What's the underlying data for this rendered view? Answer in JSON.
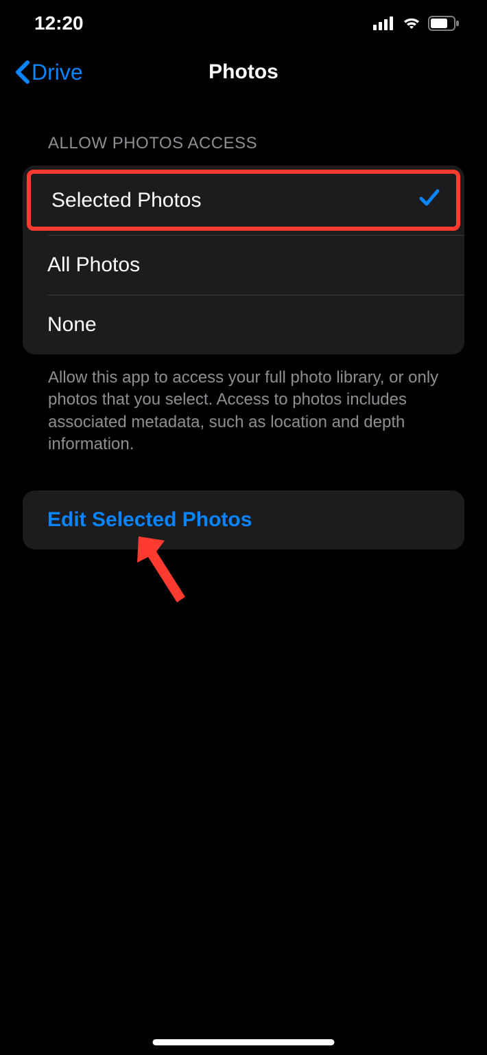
{
  "statusBar": {
    "time": "12:20"
  },
  "nav": {
    "backLabel": "Drive",
    "title": "Photos"
  },
  "section": {
    "header": "ALLOW PHOTOS ACCESS",
    "options": [
      {
        "label": "Selected Photos",
        "selected": true,
        "highlighted": true
      },
      {
        "label": "All Photos",
        "selected": false,
        "highlighted": false
      },
      {
        "label": "None",
        "selected": false,
        "highlighted": false
      }
    ],
    "description": "Allow this app to access your full photo library, or only photos that you select. Access to photos includes associated metadata, such as location and depth information."
  },
  "action": {
    "editLabel": "Edit Selected Photos"
  }
}
